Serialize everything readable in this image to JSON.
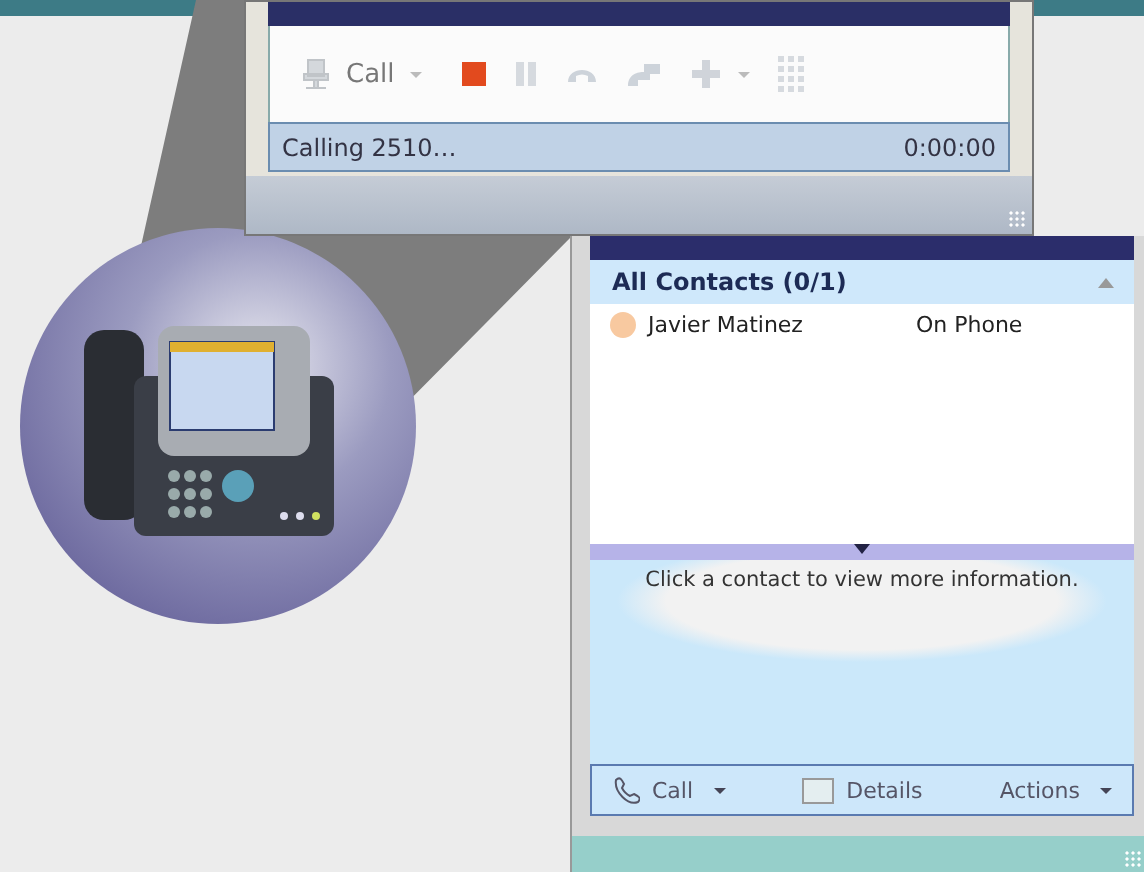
{
  "call_window": {
    "toolbar": {
      "call_label": "Call"
    },
    "status": "Calling 2510…",
    "timer": "0:00:00"
  },
  "contacts_panel": {
    "group": {
      "label": "All Contacts (0/1)",
      "expanded": true
    },
    "contacts": [
      {
        "name": "Javier Matinez",
        "status": "On Phone",
        "color": "#f8c9a0"
      }
    ],
    "info": "Click a contact to view more information.",
    "footer": {
      "call": "Call",
      "details": "Details",
      "actions": "Actions"
    }
  }
}
